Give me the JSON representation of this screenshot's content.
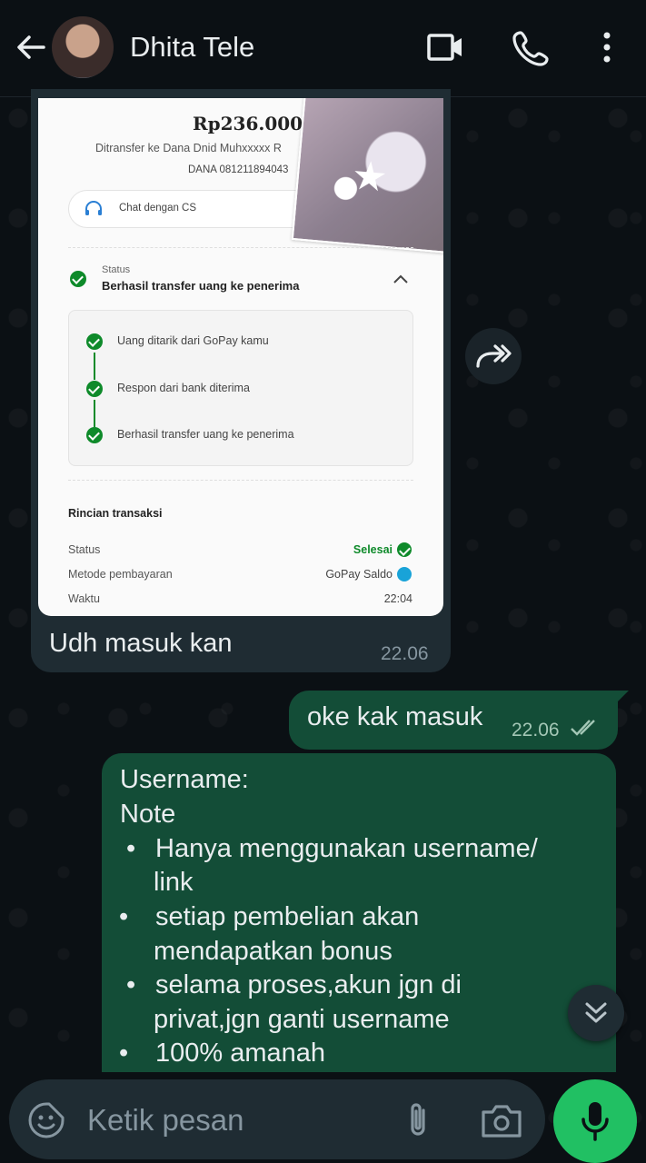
{
  "header": {
    "contact_name": "Dhita Tele"
  },
  "incoming": {
    "screenshot": {
      "amount": "Rp236.000",
      "transfer_to": "Ditransfer ke Dana Dnid Muhxxxxx R",
      "account": "DANA 081211894043",
      "chat_cs": "Chat dengan CS",
      "status_label": "Status",
      "status_value": "Berhasil transfer uang ke penerima",
      "steps": [
        "Uang ditarik dari GoPay kamu",
        "Respon dari bank diterima",
        "Berhasil transfer uang ke penerima"
      ],
      "details_title": "Rincian transaksi",
      "details": [
        {
          "label": "Status",
          "value": "Selesai"
        },
        {
          "label": "Metode pembayaran",
          "value": "GoPay Saldo"
        },
        {
          "label": "Waktu",
          "value": "22:04"
        }
      ]
    },
    "caption": "Udh masuk kan",
    "time": "22.06"
  },
  "outgoing": [
    {
      "text": "oke kak masuk",
      "time": "22.06"
    },
    {
      "lines": [
        "Username:",
        "Note",
        "Hanya menggunakan username/",
        "link",
        "setiap pembelian akan",
        "mendapatkan bonus",
        "selama proses,akun jgn di",
        "privat,jgn ganti username",
        "100% amanah"
      ]
    }
  ],
  "composer": {
    "placeholder": "Ketik pesan"
  },
  "colors": {
    "background": "#0b1014",
    "incoming_bubble": "#1f2c33",
    "outgoing_bubble": "#134d37",
    "mic_button": "#21c063"
  }
}
